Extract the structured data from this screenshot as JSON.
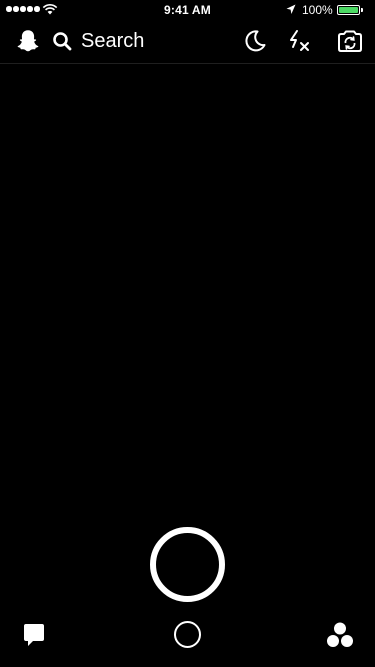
{
  "status_bar": {
    "time": "9:41 AM",
    "battery_percent": "100%",
    "signal_bars": 5,
    "battery_level": 1.0,
    "battery_color": "#4cd964"
  },
  "top_bar": {
    "search_label": "Search",
    "left_icon": "snapchat-ghost-icon",
    "search_icon": "search-icon",
    "right_icons": [
      "night-mode-moon-icon",
      "flash-off-icon",
      "flip-camera-icon"
    ]
  },
  "camera": {
    "shutter_icon": "capture-ring"
  },
  "bottom_nav": {
    "left_icon": "chat-bubble-icon",
    "center_icon": "memories-circle-icon",
    "right_icon": "stories-icon"
  },
  "colors": {
    "background": "#000000",
    "foreground": "#ffffff"
  }
}
